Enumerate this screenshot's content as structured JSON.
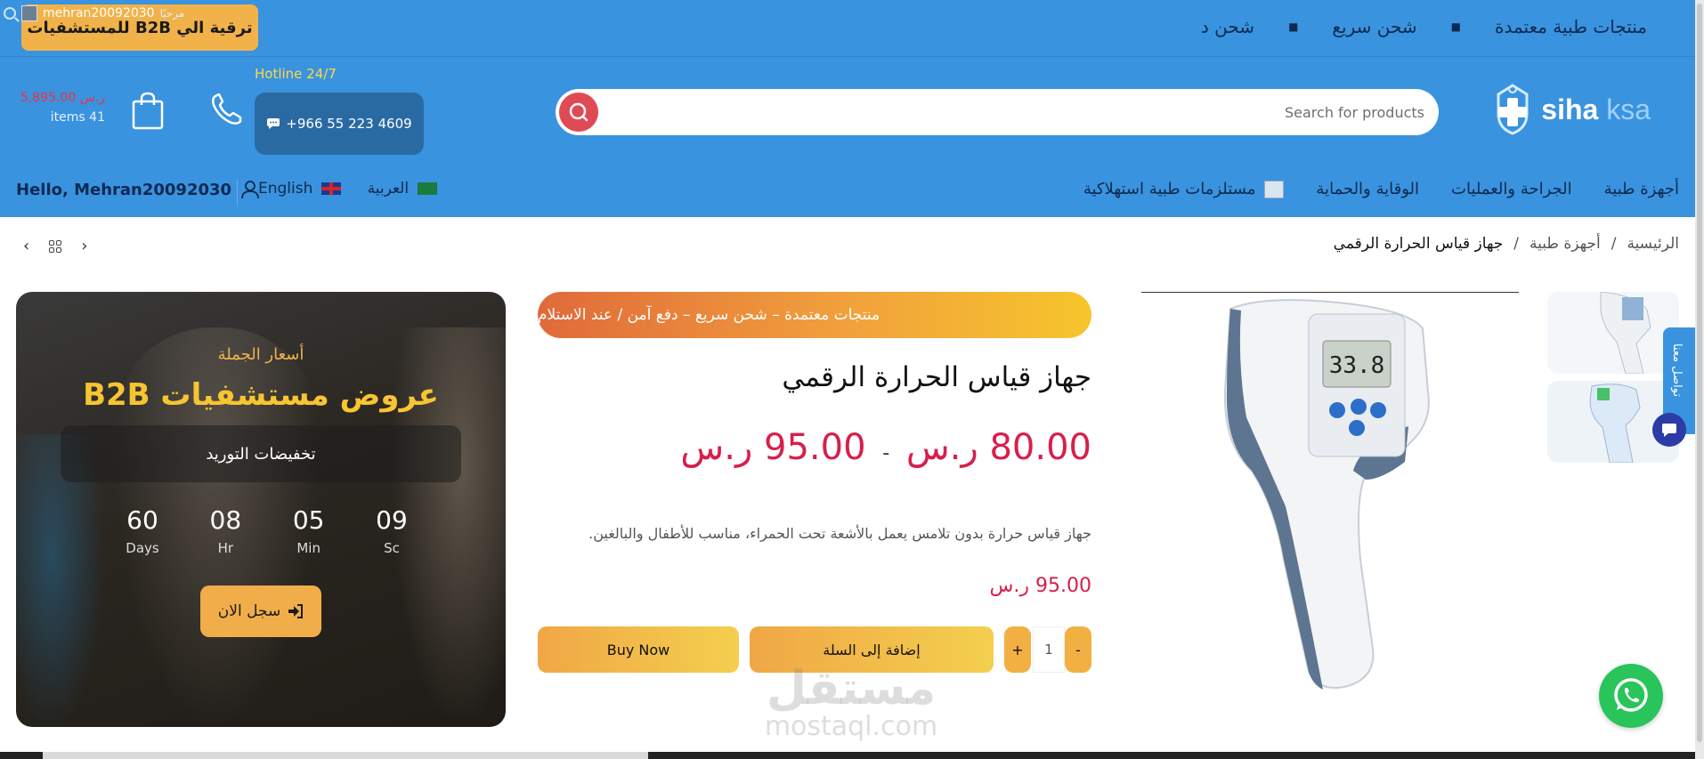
{
  "topbar": {
    "ticker": [
      "منتجات طبية معتمدة",
      "شحن سريع",
      "شحن د"
    ],
    "upgrade_label": "ترقية الي B2B للمستشفيات",
    "mini_user": "mehran20092030",
    "mini_welcome": "مرحبًا"
  },
  "header": {
    "logo": {
      "siha": "siha",
      "ksa": "ksa"
    },
    "search_placeholder": "Search for products",
    "hotline_label": "Hotline 24/7",
    "hotline_number": "+966 55 223 4609",
    "cart_total": "5,895.00 ر.س",
    "cart_items": "items 41"
  },
  "nav": {
    "items": [
      "أجهزة طبية",
      "الجراحة والعمليات",
      "الوقاية والحماية",
      "مستلزمات طبية استهلاكية"
    ],
    "lang_ar": "العربية",
    "lang_en": "English",
    "hello": "Hello, Mehran20092030"
  },
  "breadcrumb": {
    "items": [
      "الرئيسية",
      "أجهزة طبية",
      "جهاز قياس الحرارة الرقمي"
    ],
    "sep": "/"
  },
  "product": {
    "promo": "منتجات معتمدة – شحن سريع – دفع آمن / عند الاستلام",
    "title": "جهاز قياس الحرارة الرقمي",
    "price_min": "80.00 ر.س",
    "price_sep": "-",
    "price_max": "95.00 ر.س",
    "description": "جهاز قياس حرارة بدون تلامس يعمل بالأشعة تحت الحمراء، مناسب للأطفال والبالغين.",
    "price_single": "95.00 ر.س",
    "qty": "1",
    "qty_minus": "-",
    "qty_plus": "+",
    "add_to_cart": "إضافة إلى السلة",
    "buy_now": "Buy Now",
    "display_reading": "33.8"
  },
  "b2b": {
    "subtitle": "أسعار الجملة",
    "heading": "عروض مستشفيات B2B",
    "band": "تخفيضات التوريد",
    "countdown": [
      {
        "value": "60",
        "label": "Days"
      },
      {
        "value": "08",
        "label": "Hr"
      },
      {
        "value": "05",
        "label": "Min"
      },
      {
        "value": "09",
        "label": "Sc"
      }
    ],
    "register": "سجل الان"
  },
  "widgets": {
    "side_tab": "تواصل معنا"
  },
  "watermark": {
    "ar": "مستقل",
    "en": "mostaql.com"
  },
  "colors": {
    "brand_blue": "#3a93de",
    "accent_yellow": "#f1b24a",
    "price_red": "#d81e4a",
    "whatsapp": "#29c45a"
  }
}
